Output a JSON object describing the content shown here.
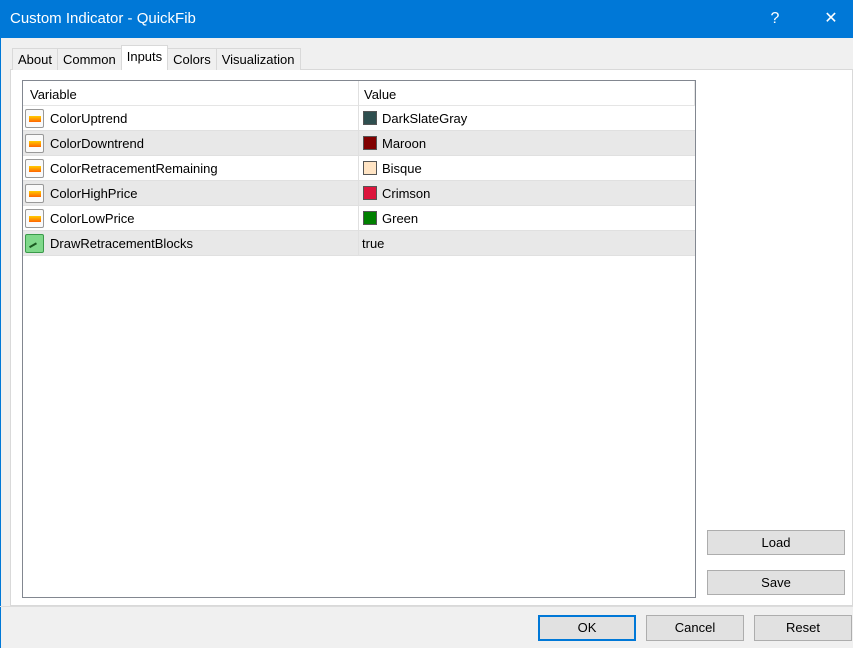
{
  "window": {
    "title": "Custom Indicator - QuickFib",
    "help": "?",
    "close": "✕"
  },
  "tabs": [
    {
      "label": "About"
    },
    {
      "label": "Common"
    },
    {
      "label": "Inputs"
    },
    {
      "label": "Colors"
    },
    {
      "label": "Visualization"
    }
  ],
  "active_tab": "Inputs",
  "grid": {
    "headers": {
      "variable": "Variable",
      "value": "Value"
    },
    "rows": [
      {
        "name": "ColorUptrend",
        "value": "DarkSlateGray",
        "color": "#2f4f4f",
        "type": "color"
      },
      {
        "name": "ColorDowntrend",
        "value": "Maroon",
        "color": "#800000",
        "type": "color"
      },
      {
        "name": "ColorRetracementRemaining",
        "value": "Bisque",
        "color": "#ffe4c4",
        "type": "color"
      },
      {
        "name": "ColorHighPrice",
        "value": "Crimson",
        "color": "#dc143c",
        "type": "color"
      },
      {
        "name": "ColorLowPrice",
        "value": "Green",
        "color": "#008000",
        "type": "color"
      },
      {
        "name": "DrawRetracementBlocks",
        "value": "true",
        "type": "bool"
      }
    ]
  },
  "buttons": {
    "load": "Load",
    "save": "Save",
    "ok": "OK",
    "cancel": "Cancel",
    "reset": "Reset"
  }
}
